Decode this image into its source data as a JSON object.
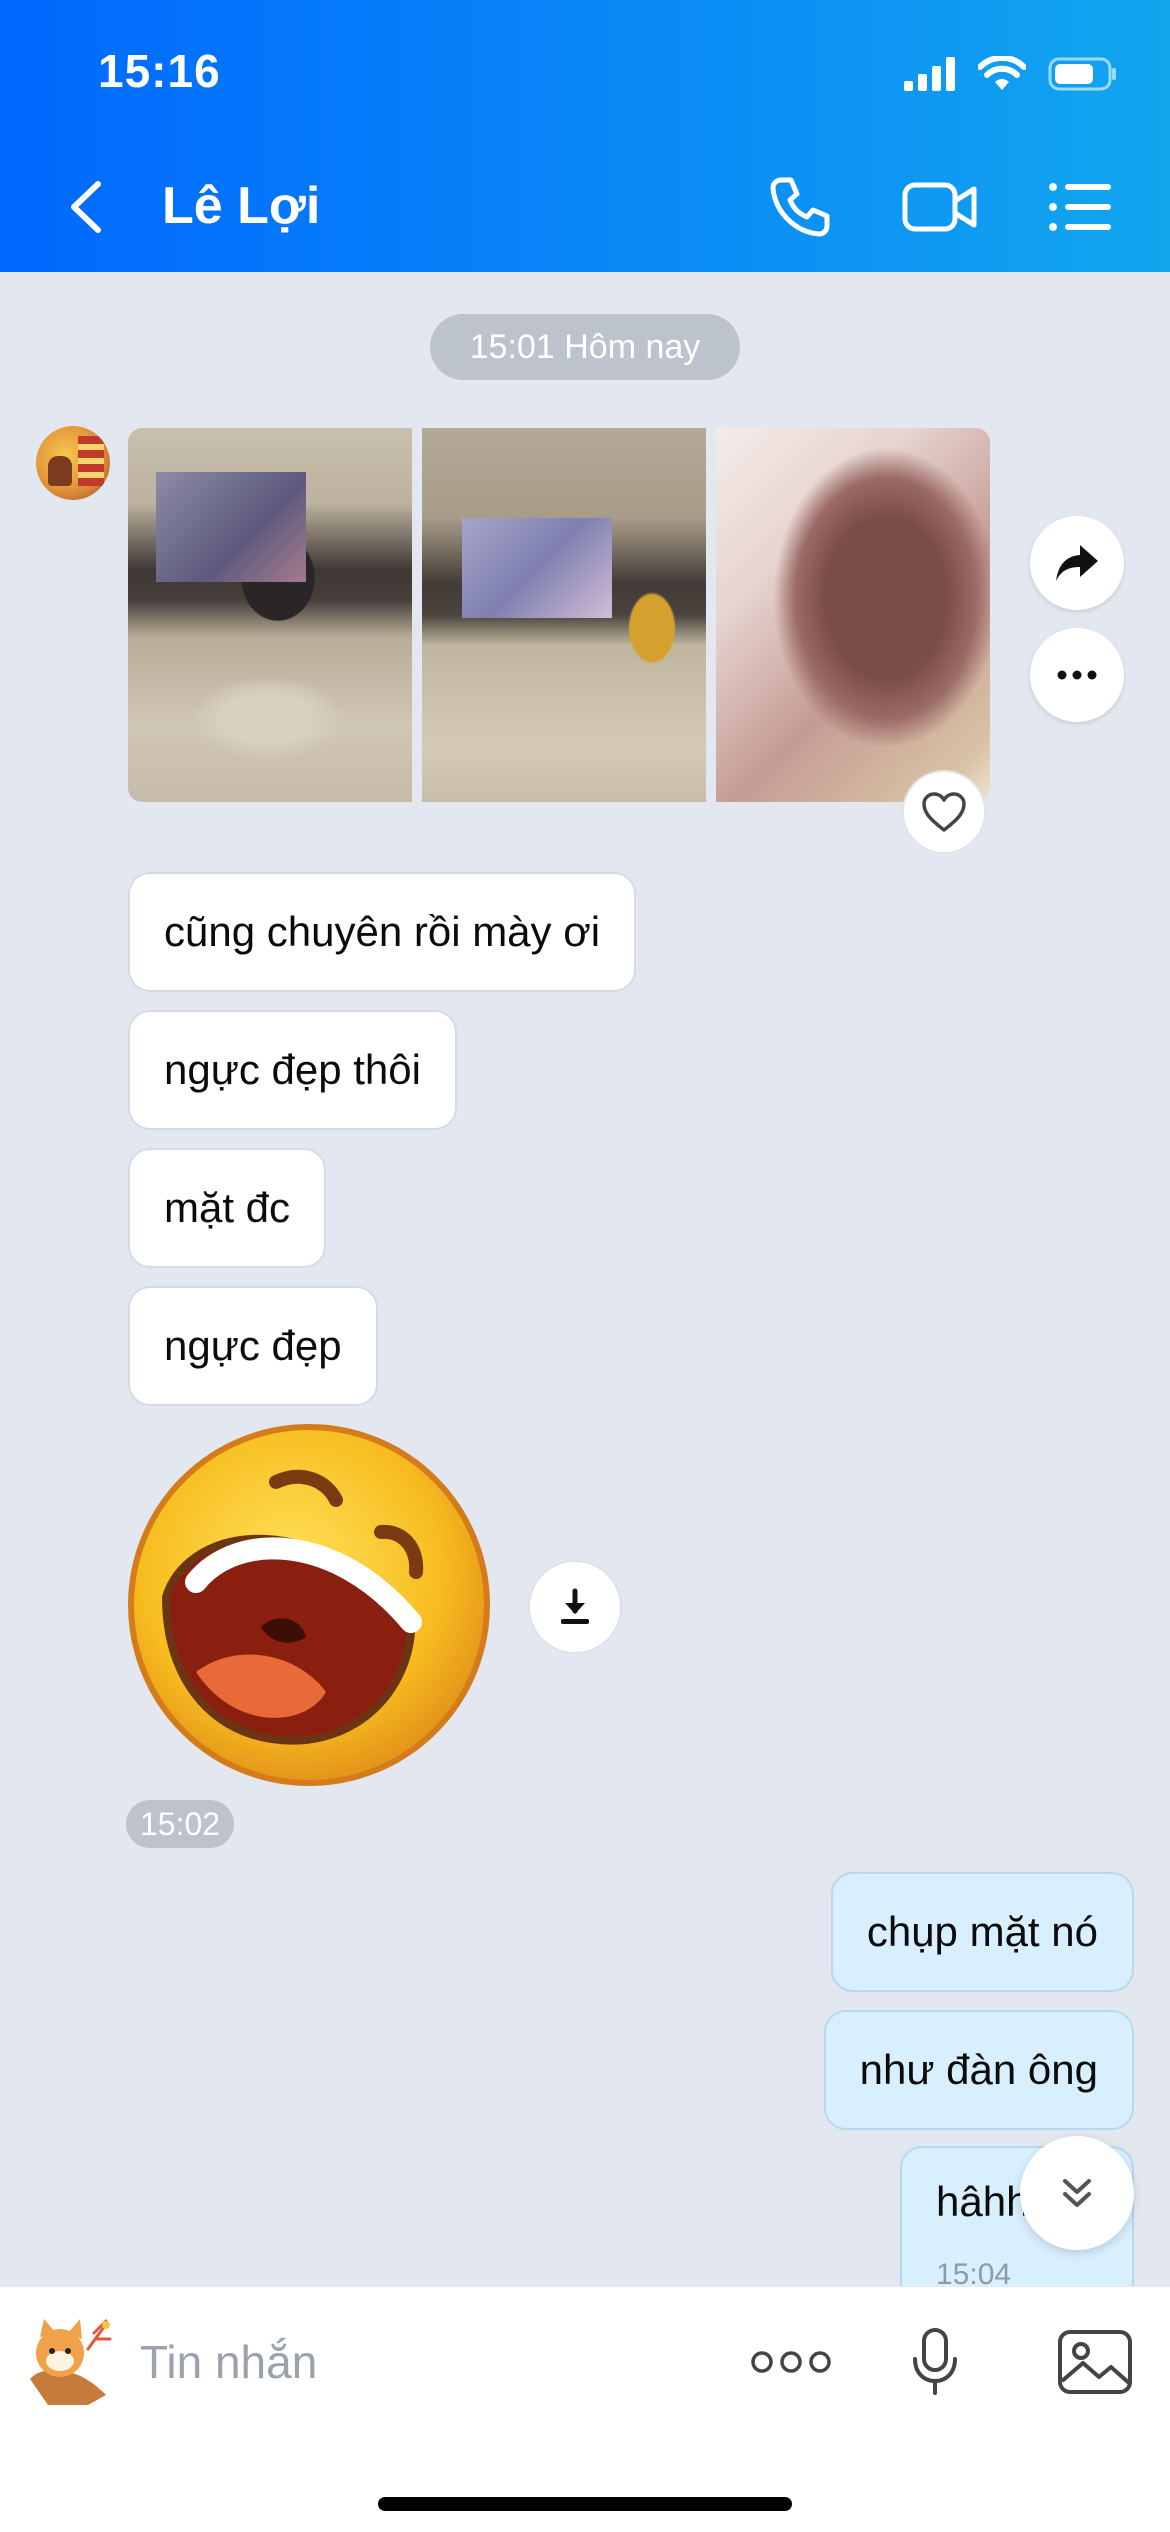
{
  "status_bar": {
    "time": "15:16"
  },
  "header": {
    "title": "Lê Lợi"
  },
  "chat": {
    "date_separator": "15:01 Hôm nay",
    "incoming_messages": [
      "cũng chuyên rồi mày ơi",
      "ngực đẹp thôi",
      "mặt đc",
      "ngực đẹp"
    ],
    "sticker_time": "15:02",
    "outgoing_messages": [
      "chụp mặt nó",
      "như đàn ông"
    ],
    "last_outgoing": {
      "text": "hâhh",
      "time": "15:04"
    }
  },
  "input_bar": {
    "placeholder": "Tin nhắn"
  },
  "colors": {
    "header_start": "#0068ff",
    "header_end": "#12a6ef",
    "chat_background": "#e3e8f0",
    "outgoing_bubble": "#d7effe",
    "incoming_bubble": "#ffffff"
  },
  "icons": {
    "header": [
      "back-arrow-icon",
      "phone-icon",
      "video-call-icon",
      "list-menu-icon"
    ],
    "status": [
      "cellular-signal-icon",
      "wifi-icon",
      "battery-icon"
    ],
    "input": [
      "sticker-icon",
      "more-options-icon",
      "microphone-icon",
      "image-icon"
    ]
  }
}
